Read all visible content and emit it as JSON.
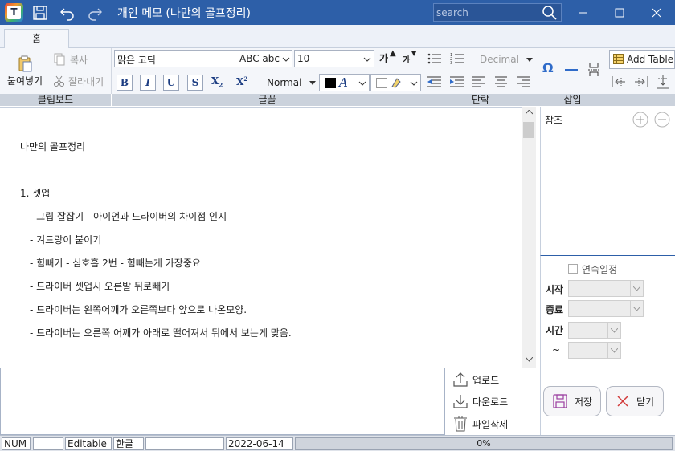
{
  "window": {
    "title": "개인 메모 (나만의 골프정리)",
    "logo_letter": "T",
    "search_placeholder": "search"
  },
  "tabs": [
    {
      "label": "홈",
      "active": true
    }
  ],
  "ribbon": {
    "clipboard": {
      "group_label": "클립보드",
      "paste_label": "붙여넣기",
      "copy_label": "복사",
      "cut_label": "잘라내기"
    },
    "font": {
      "group_label": "글꼴",
      "font_name": "맑은 고딕",
      "font_preview": "ABC abc",
      "font_size": "10",
      "grow_label": "가",
      "shrink_label": "가",
      "bold": "B",
      "italic": "I",
      "underline": "U",
      "strike": "S",
      "subscript": "X",
      "superscript": "X",
      "style_name": "Normal",
      "font_color_glyph": "A"
    },
    "paragraph": {
      "group_label": "단락",
      "list_style": "Decimal"
    },
    "insert": {
      "group_label": "삽입",
      "omega": "Ω",
      "add_table_label": "Add Table"
    }
  },
  "document": {
    "lines": [
      "나만의 골프정리",
      "1. 셋업",
      "- 그립 잘잡기 - 아이언과 드라이버의 차이점 인지",
      "- 겨드랑이 붙이기",
      "- 힘빼기 - 심호흡 2번 - 힘빼는게 가장중요",
      "- 드라이버 셋업시 오른발 뒤로빼기",
      "- 드라이버는 왼쪽어깨가 오른쪽보다 앞으로 나온모양.",
      "- 드라이버는 오른쪽 어깨가 아래로 떨어져서 뒤에서 보는게 맞음."
    ]
  },
  "side_panel": {
    "reference_label": "참조",
    "continuous_label": "연속일정",
    "start_label": "시작",
    "end_label": "종료",
    "time_label": "시간",
    "tilde": "~"
  },
  "attachments": {
    "upload_label": "업로드",
    "download_label": "다운로드",
    "delete_label": "파일삭제"
  },
  "actions": {
    "save_label": "저장",
    "close_label": "닫기"
  },
  "status": {
    "num": "NUM",
    "mode": "Editable",
    "ime": "한글",
    "date": "2022-06-14",
    "progress_text": "0%",
    "progress_value": 0
  },
  "colors": {
    "titlebar": "#2d5fa8",
    "ribbon_bg": "#f4f6fa",
    "group_label_bg": "#cbd2dc",
    "accent_blue": "#1c3d82",
    "save_icon": "#9b3fa0",
    "close_icon": "#d23b3b"
  }
}
